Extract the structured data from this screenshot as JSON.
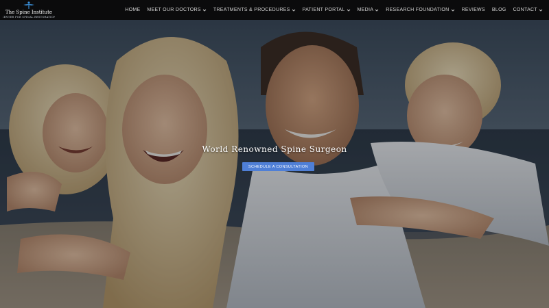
{
  "header": {
    "logo": {
      "title": "The Spine Institute",
      "subtitle": "Center for Spinal Restoration",
      "icon": "spine-figure-icon"
    },
    "nav": [
      {
        "label": "HOME",
        "dropdown": false
      },
      {
        "label": "MEET OUR DOCTORS",
        "dropdown": true
      },
      {
        "label": "TREATMENTS & PROCEDURES",
        "dropdown": true
      },
      {
        "label": "PATIENT PORTAL",
        "dropdown": true
      },
      {
        "label": "MEDIA",
        "dropdown": true
      },
      {
        "label": "RESEARCH FOUNDATION",
        "dropdown": true
      },
      {
        "label": "REVIEWS",
        "dropdown": false
      },
      {
        "label": "BLOG",
        "dropdown": false
      },
      {
        "label": "CONTACT",
        "dropdown": true
      }
    ]
  },
  "hero": {
    "title": "World Renowned Spine Surgeon",
    "cta_label": "SCHEDULE A CONSULTATION"
  },
  "colors": {
    "header_bg": "#0b0b0c",
    "nav_text": "#d6d6d6",
    "cta_bg": "#4f7fd6",
    "logo_accent": "#3a8fd8"
  }
}
